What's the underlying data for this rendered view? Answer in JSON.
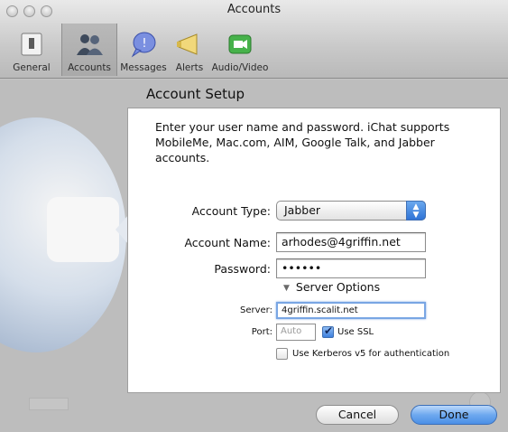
{
  "window": {
    "title": "Accounts"
  },
  "toolbar": {
    "items": [
      {
        "label": "General",
        "icon": "switch-icon"
      },
      {
        "label": "Accounts",
        "icon": "people-icon",
        "selected": true
      },
      {
        "label": "Messages",
        "icon": "speech-bubble-icon"
      },
      {
        "label": "Alerts",
        "icon": "megaphone-icon"
      },
      {
        "label": "Audio/Video",
        "icon": "video-camera-icon"
      }
    ]
  },
  "sheet": {
    "title": "Account Setup",
    "intro": "Enter your user name and password. iChat supports MobileMe, Mac.com, AIM, Google Talk, and Jabber accounts.",
    "account_type_label": "Account Type:",
    "account_type_value": "Jabber",
    "account_name_label": "Account Name:",
    "account_name_value": "arhodes@4griffin.net",
    "password_label": "Password:",
    "password_value": "••••••",
    "server_options_label": "Server Options",
    "server_label": "Server:",
    "server_value": "4griffin.scalit.net",
    "port_label": "Port:",
    "port_placeholder": "Auto",
    "use_ssl_label": "Use SSL",
    "use_ssl_checked": true,
    "kerberos_label": "Use Kerberos v5 for authentication",
    "kerberos_checked": false,
    "cancel_label": "Cancel",
    "done_label": "Done"
  },
  "colors": {
    "accent": "#4b8fe6",
    "focus_ring": "#79a6e4"
  }
}
